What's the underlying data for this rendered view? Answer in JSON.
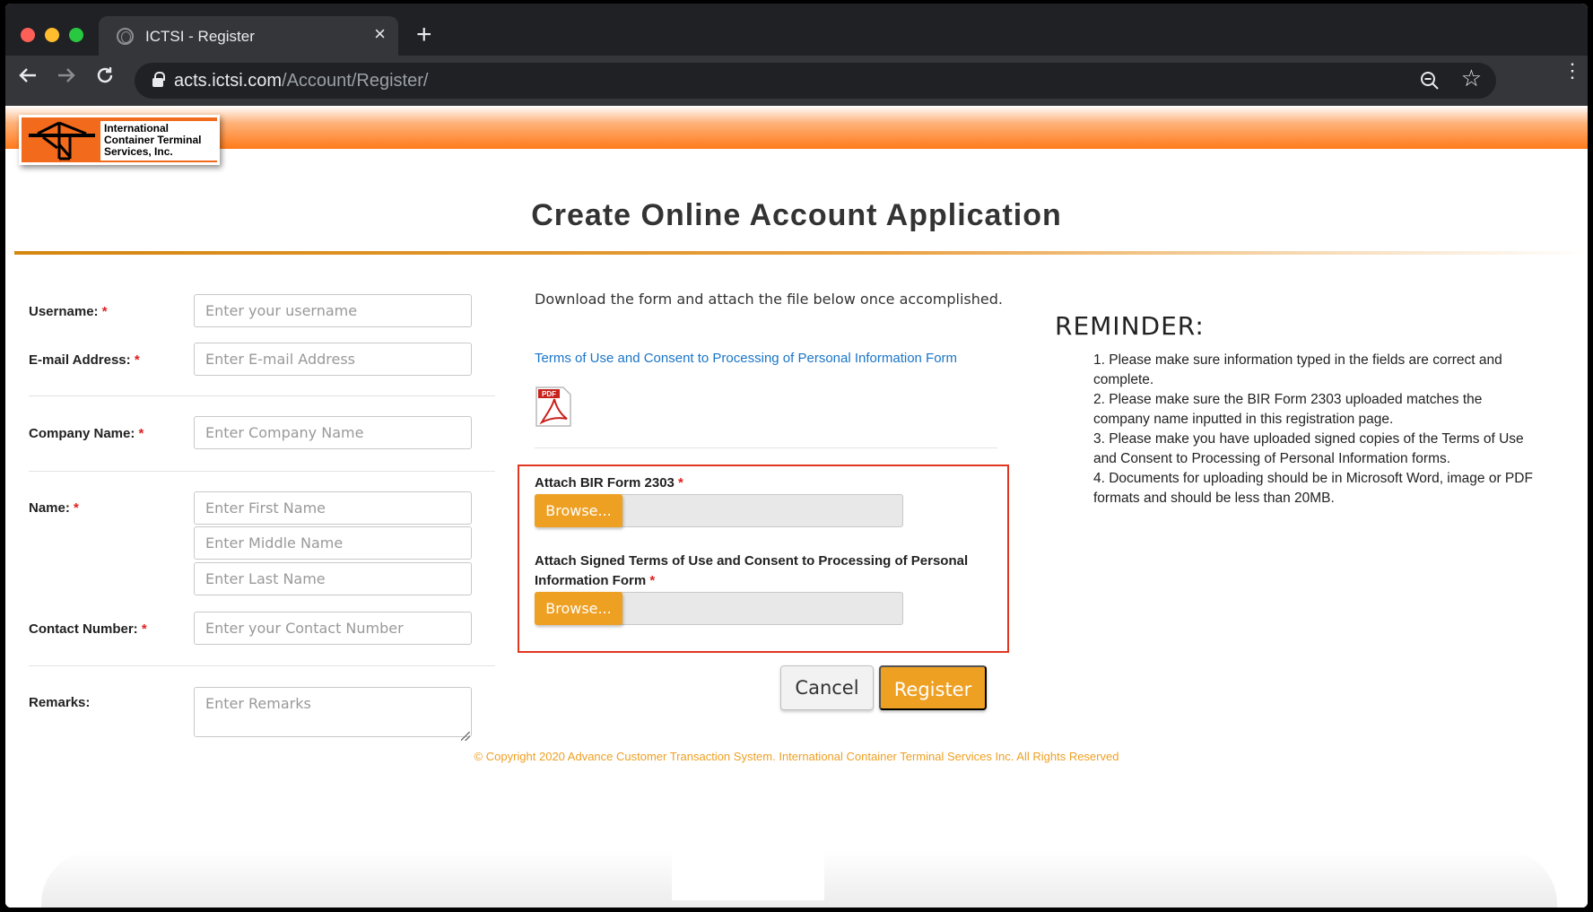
{
  "browser": {
    "tab_title": "ICTSI - Register",
    "tab_close": "×",
    "new_tab": "+",
    "url_host": "acts.ictsi.com",
    "url_path": "/Account/Register/"
  },
  "logo": {
    "text": "International Container Terminal Services, Inc."
  },
  "page": {
    "title": "Create Online Account Application"
  },
  "form": {
    "username": {
      "label": "Username:",
      "placeholder": "Enter your username"
    },
    "email": {
      "label": "E-mail Address:",
      "placeholder": "Enter E-mail Address"
    },
    "company": {
      "label": "Company Name:",
      "placeholder": "Enter Company Name"
    },
    "name": {
      "label": "Name:",
      "first_placeholder": "Enter First Name",
      "middle_placeholder": "Enter Middle Name",
      "last_placeholder": "Enter Last Name"
    },
    "contact": {
      "label": "Contact Number:",
      "placeholder": "Enter your Contact Number"
    },
    "remarks": {
      "label": "Remarks:",
      "placeholder": "Enter Remarks"
    },
    "required_marker": "*"
  },
  "attachments": {
    "instruction": "Download the form and attach the file below once accomplished.",
    "form_link": "Terms of Use and Consent to Processing of Personal Information Form",
    "pdf_icon_label": "PDF",
    "bir_label": "Attach BIR Form 2303",
    "terms_label": "Attach Signed Terms of Use and Consent to Processing of Personal Information Form",
    "browse_label": "Browse..."
  },
  "actions": {
    "cancel": "Cancel",
    "register": "Register"
  },
  "reminder": {
    "title": "REMINDER:",
    "items": [
      "1. Please make sure information typed in the fields are correct and complete.",
      "2. Please make sure the BIR Form 2303 uploaded matches the company name inputted in this registration page.",
      "3. Please make you have uploaded signed copies of the Terms of Use and Consent to Processing of Personal Information forms.",
      "4. Documents for uploading should be in Microsoft Word, image or PDF formats and should be less than 20MB."
    ]
  },
  "footer": {
    "copyright": "© Copyright 2020 Advance Customer Transaction System. International Container Terminal Services Inc. All Rights Reserved"
  },
  "colors": {
    "accent": "#eea023",
    "brand_orange": "#f26a1b",
    "highlight_border": "#e0361f",
    "link": "#1a75c8"
  }
}
